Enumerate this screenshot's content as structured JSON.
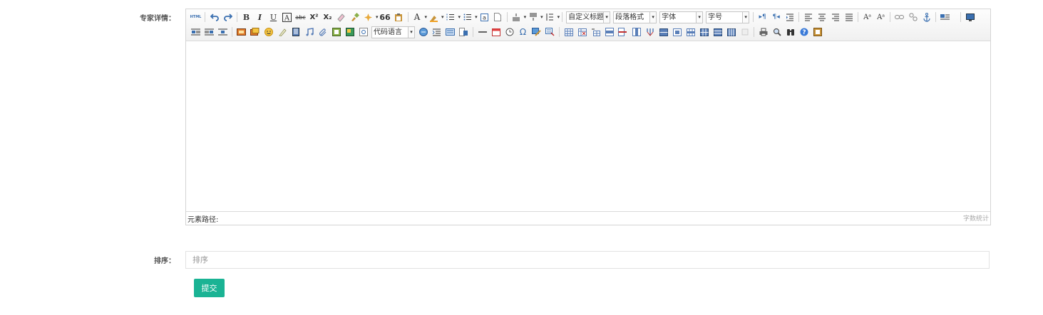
{
  "form": {
    "detail_label": "专家详情：",
    "sort_label": "排序：",
    "sort_placeholder": "排序",
    "submit_label": "提交"
  },
  "editor": {
    "toolbar": {
      "code_language": "代码语言",
      "custom_title": "自定义标题",
      "paragraph_format": "段落格式",
      "font_family": "字体",
      "font_size": "字号",
      "bold": "B",
      "italic": "I",
      "underline": "U",
      "strikethrough": "abc",
      "superscript": "X²",
      "subscript": "X₂",
      "blockquote": "66",
      "font_color": "A",
      "omega": "Ω",
      "html_source": "HTML"
    },
    "element_path": "元素路径:",
    "word_count": "字数统计"
  }
}
